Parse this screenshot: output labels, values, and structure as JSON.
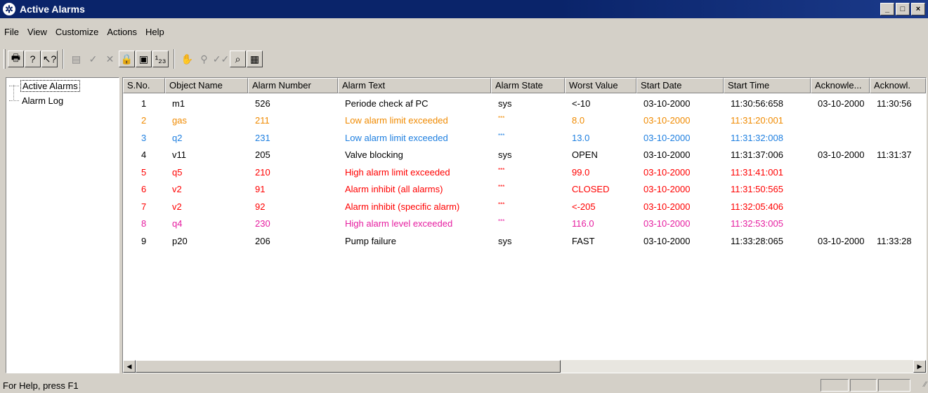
{
  "window": {
    "title": "Active Alarms",
    "min": "_",
    "max": "□",
    "close": "×",
    "app_icon": "✲"
  },
  "menu": [
    "File",
    "View",
    "Customize",
    "Actions",
    "Help"
  ],
  "toolbar": {
    "groups": [
      [
        {
          "icon": "print-icon",
          "glyph": "🖶",
          "enabled": true
        },
        {
          "icon": "help-icon",
          "glyph": "?",
          "enabled": true
        },
        {
          "icon": "context-help-icon",
          "glyph": "↖?",
          "enabled": true
        }
      ],
      [
        {
          "icon": "properties-icon",
          "glyph": "▤",
          "enabled": false
        },
        {
          "icon": "acknowledge-icon",
          "glyph": "✓",
          "enabled": false
        },
        {
          "icon": "delete-icon",
          "glyph": "✕",
          "enabled": false
        },
        {
          "icon": "lock-icon",
          "glyph": "🔒",
          "enabled": true
        },
        {
          "icon": "notepad-icon",
          "glyph": "▣",
          "enabled": true
        },
        {
          "icon": "sequence-icon",
          "glyph": "¹₂₃",
          "enabled": true
        }
      ],
      [
        {
          "icon": "handshake-icon",
          "glyph": "✋",
          "enabled": false
        },
        {
          "icon": "find-icon",
          "glyph": "⚲",
          "enabled": false
        },
        {
          "icon": "ack-all-icon",
          "glyph": "✓✓",
          "enabled": false
        },
        {
          "icon": "zoom-icon",
          "glyph": "⌕",
          "enabled": true
        },
        {
          "icon": "package-icon",
          "glyph": "▦",
          "enabled": true
        }
      ]
    ]
  },
  "tree": {
    "items": [
      {
        "label": "Active Alarms",
        "selected": true
      },
      {
        "label": "Alarm Log",
        "selected": false
      }
    ]
  },
  "table": {
    "columns": [
      "S.No.",
      "Object Name",
      "Alarm Number",
      "Alarm Text",
      "Alarm State",
      "Worst Value",
      "Start Date",
      "Start Time",
      "Acknowle...",
      "Acknowl."
    ],
    "rows": [
      {
        "color": "#000000",
        "cells": [
          "1",
          "m1",
          "526",
          "Periode check af PC",
          "sys",
          "<-10",
          "03-10-2000",
          "11:30:56:658",
          "03-10-2000",
          "11:30:56"
        ]
      },
      {
        "color": "#f08a00",
        "cells": [
          "2",
          "gas",
          "211",
          "Low alarm limit exceeded",
          "***",
          "8.0",
          "03-10-2000",
          "11:31:20:001",
          "",
          ""
        ]
      },
      {
        "color": "#1e7fe0",
        "cells": [
          "3",
          "q2",
          "231",
          "Low alarm limit exceeded",
          "***",
          "13.0",
          "03-10-2000",
          "11:31:32:008",
          "",
          ""
        ]
      },
      {
        "color": "#000000",
        "cells": [
          "4",
          "v11",
          "205",
          "Valve blocking",
          "sys",
          "OPEN",
          "03-10-2000",
          "11:31:37:006",
          "03-10-2000",
          "11:31:37"
        ]
      },
      {
        "color": "#ff0000",
        "cells": [
          "5",
          "q5",
          "210",
          "High alarm limit exceeded",
          "***",
          "99.0",
          "03-10-2000",
          "11:31:41:001",
          "",
          ""
        ]
      },
      {
        "color": "#ff0000",
        "cells": [
          "6",
          "v2",
          "91",
          "Alarm inhibit (all alarms)",
          "***",
          "CLOSED",
          "03-10-2000",
          "11:31:50:565",
          "",
          ""
        ]
      },
      {
        "color": "#ff0000",
        "cells": [
          "7",
          "v2",
          "92",
          "Alarm inhibit (specific alarm)",
          "***",
          "<-205",
          "03-10-2000",
          "11:32:05:406",
          "",
          ""
        ]
      },
      {
        "color": "#e61ea0",
        "cells": [
          "8",
          "q4",
          "230",
          "High alarm level exceeded",
          "***",
          "116.0",
          "03-10-2000",
          "11:32:53:005",
          "",
          ""
        ]
      },
      {
        "color": "#000000",
        "cells": [
          "9",
          "p20",
          "206",
          "Pump failure",
          "sys",
          "FAST",
          "03-10-2000",
          "11:33:28:065",
          "03-10-2000",
          "11:33:28"
        ]
      }
    ]
  },
  "scroll": {
    "left": "◀",
    "right": "▶"
  },
  "status": {
    "text": "For Help, press F1",
    "grip": "⁄⁄"
  }
}
